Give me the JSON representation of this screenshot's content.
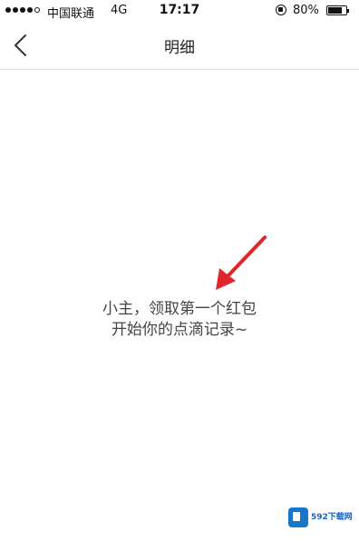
{
  "status_bar": {
    "carrier": "中国联通",
    "network": "4G",
    "time": "17:17",
    "battery": "80%",
    "battery_level": 0.8
  },
  "nav": {
    "title": "明细",
    "back_icon": "chevron-left-icon"
  },
  "empty_state": {
    "line1": "小主，领取第一个红包",
    "line2": "开始你的点滴记录~",
    "annotation_color": "#e0262b"
  },
  "watermark": {
    "text": "592下载网"
  }
}
